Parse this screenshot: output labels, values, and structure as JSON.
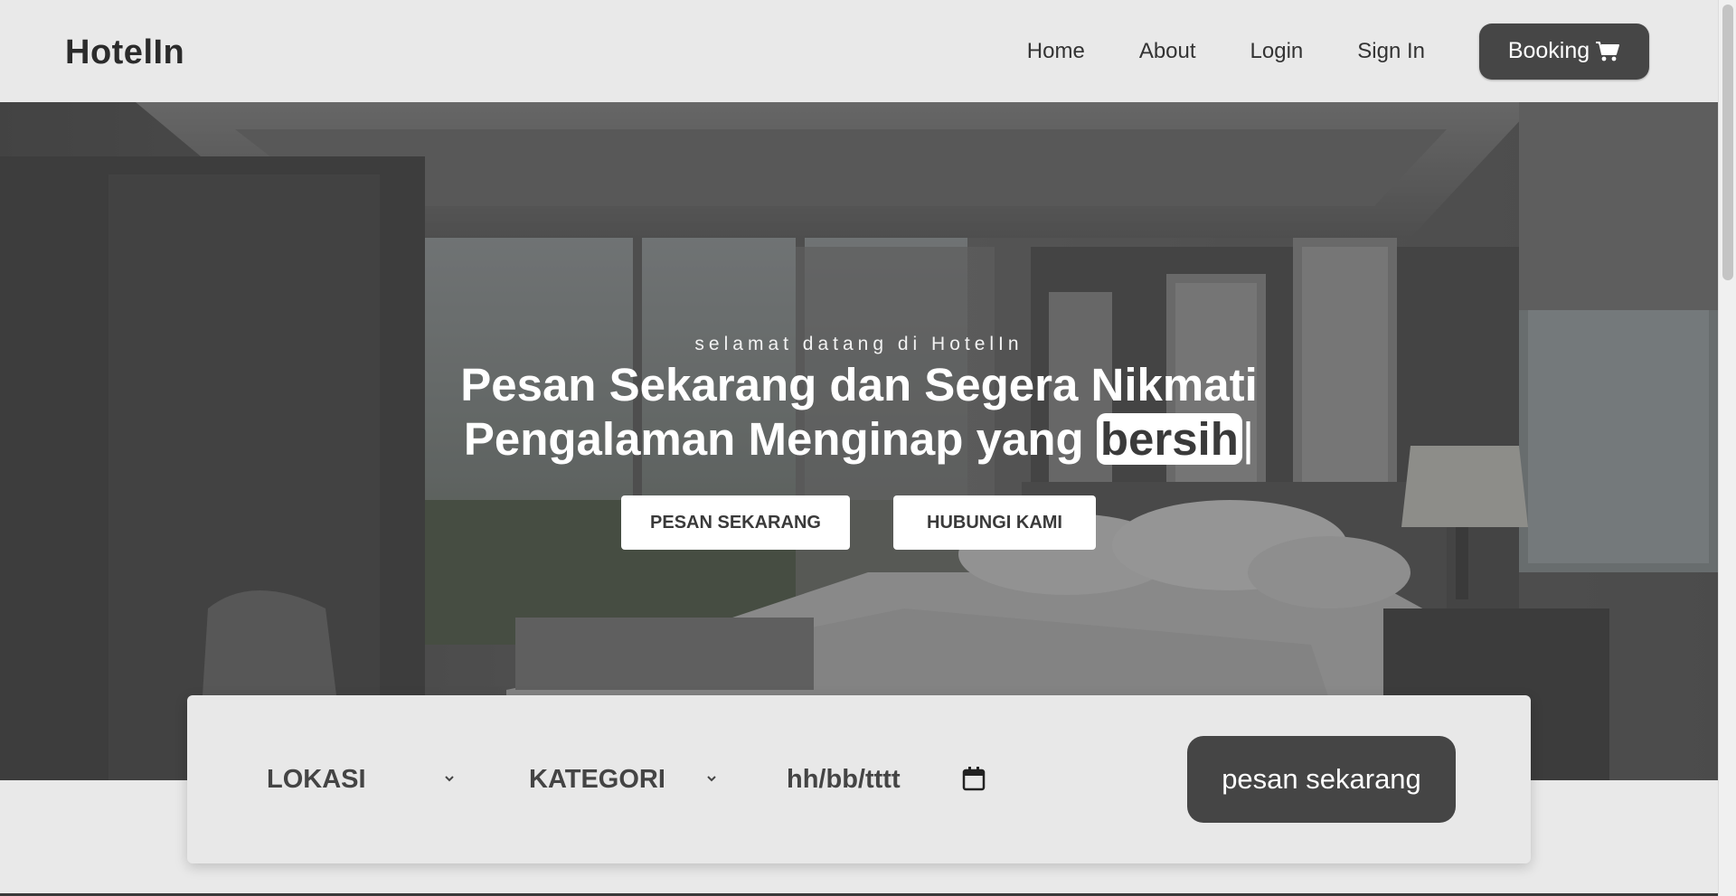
{
  "brand": {
    "logo": "HotelIn"
  },
  "nav": {
    "items": [
      {
        "label": "Home"
      },
      {
        "label": "About"
      },
      {
        "label": "Login"
      },
      {
        "label": "Sign In"
      }
    ],
    "booking_label": "Booking",
    "booking_icon": "cart-icon"
  },
  "hero": {
    "welcome": "selamat datang di HotelIn",
    "headline_line1": "Pesan Sekarang dan Segera Nikmati",
    "headline_line2": "Pengalaman Menginap yang",
    "typed_word": "bersih",
    "caret": "|",
    "primary_button": "PESAN SEKARANG",
    "secondary_button": "HUBUNGI KAMI"
  },
  "booking_bar": {
    "location_label": "LOKASI",
    "category_label": "KATEGORI",
    "date_placeholder": "hh/bb/tttt",
    "date_icon": "calendar-icon",
    "submit_label": "pesan sekarang"
  },
  "colors": {
    "dark_button": "#454545",
    "page_bg": "#e9e9e9",
    "text_dark": "#333333"
  }
}
